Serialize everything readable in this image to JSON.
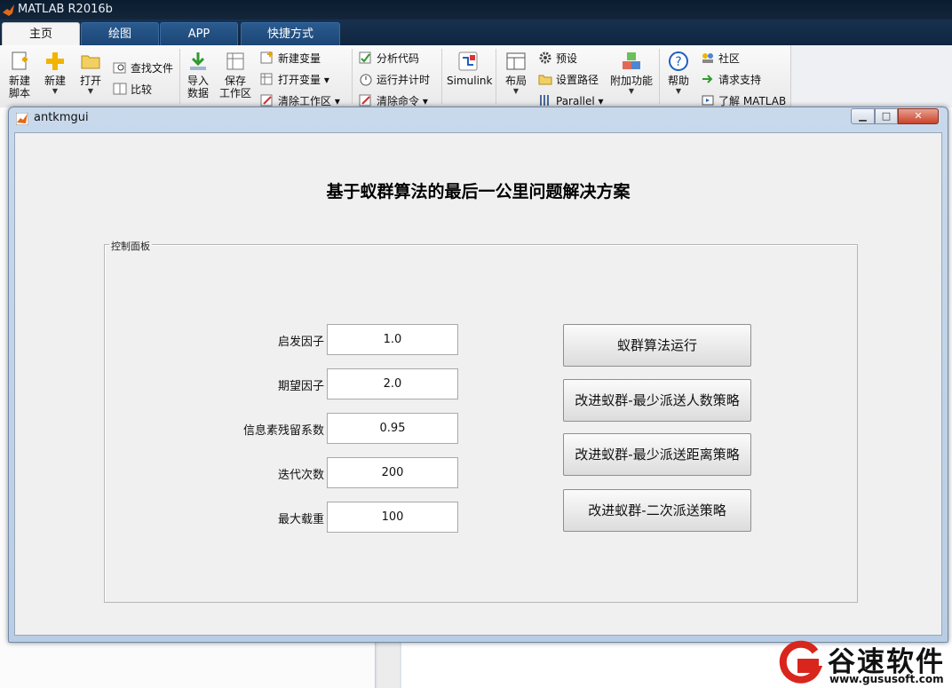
{
  "app": {
    "title": "MATLAB R2016b"
  },
  "tabs": [
    "主页",
    "绘图",
    "APP",
    "快捷方式"
  ],
  "toolstrip": {
    "new_script": "新建\n脚本",
    "new": "新建",
    "open": "打开",
    "find_files": "查找文件",
    "compare": "比较",
    "import_data": "导入\n数据",
    "save_workspace": "保存\n工作区",
    "new_variable": "新建变量",
    "open_variable": "打开变量",
    "clear_workspace": "清除工作区",
    "analyze_code": "分析代码",
    "run_and_time": "运行并计时",
    "clear_commands": "清除命令",
    "simulink": "Simulink",
    "layout": "布局",
    "preferences": "预设",
    "set_path": "设置路径",
    "parallel": "Parallel",
    "add_ons": "附加功能",
    "help": "帮助",
    "community": "社区",
    "request_support": "请求支持",
    "learn_matlab": "了解 MATLAB"
  },
  "figure": {
    "window_title": "antkmgui",
    "heading": "基于蚁群算法的最后一公里问题解决方案",
    "panel_title": "控制面板",
    "params": [
      {
        "label": "启发因子",
        "value": "1.0"
      },
      {
        "label": "期望因子",
        "value": "2.0"
      },
      {
        "label": "信息素残留系数",
        "value": "0.95"
      },
      {
        "label": "迭代次数",
        "value": "200"
      },
      {
        "label": "最大载重",
        "value": "100"
      }
    ],
    "buttons": [
      "蚁群算法运行",
      "改进蚁群-最少派送人数策略",
      "改进蚁群-最少派送距离策略",
      "改进蚁群-二次派送策略"
    ]
  },
  "watermark": {
    "brand": "谷速软件",
    "url": "www.gususoft.com"
  },
  "colors": {
    "ribbon_dark": "#0f2640",
    "tab_blue": "#1c4675",
    "window_frame": "#b9cde4",
    "close_red": "#c8432a"
  }
}
